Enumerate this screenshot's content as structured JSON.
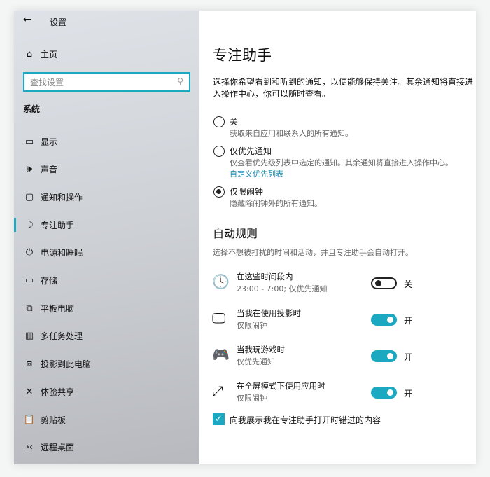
{
  "sidebar": {
    "title": "设置",
    "home": "主页",
    "search_placeholder": "查找设置",
    "section": "系统",
    "items": [
      {
        "label": "显示",
        "icon": "monitor-icon"
      },
      {
        "label": "声音",
        "icon": "speaker-icon"
      },
      {
        "label": "通知和操作",
        "icon": "message-icon"
      },
      {
        "label": "专注助手",
        "icon": "moon-icon"
      },
      {
        "label": "电源和睡眠",
        "icon": "power-icon"
      },
      {
        "label": "存储",
        "icon": "storage-icon"
      },
      {
        "label": "平板电脑",
        "icon": "tablet-icon"
      },
      {
        "label": "多任务处理",
        "icon": "multitask-icon"
      },
      {
        "label": "投影到此电脑",
        "icon": "project-icon"
      },
      {
        "label": "体验共享",
        "icon": "share-icon"
      },
      {
        "label": "剪贴板",
        "icon": "clipboard-icon"
      },
      {
        "label": "远程桌面",
        "icon": "remote-icon"
      }
    ],
    "selected": "专注助手"
  },
  "main": {
    "title": "专注助手",
    "desc": "选择你希望看到和听到的通知，以便能够保持关注。其余通知将直接进入操作中心，你可以随时查看。",
    "options": [
      {
        "label": "关",
        "desc": "获取来自应用和联系人的所有通知。",
        "selected": false
      },
      {
        "label": "仅优先通知",
        "desc": "仅查看优先级列表中选定的通知。其余通知将直接进入操作中心。",
        "link": "自定义优先列表",
        "selected": false
      },
      {
        "label": "仅限闹钟",
        "desc": "隐藏除闹钟外的所有通知。",
        "selected": true
      }
    ],
    "rules_title": "自动规则",
    "rules_desc": "选择不想被打扰的时间和活动，并且专注助手会自动打开。",
    "rules": [
      {
        "title": "在这些时间段内",
        "sub": "23:00 - 7:00; 仅优先通知",
        "state": "关",
        "on": false
      },
      {
        "title": "当我在使用投影时",
        "sub": "仅限闹钟",
        "state": "开",
        "on": true
      },
      {
        "title": "当我玩游戏时",
        "sub": "仅优先通知",
        "state": "开",
        "on": true
      },
      {
        "title": "在全屏模式下使用应用时",
        "sub": "仅限闹钟",
        "state": "开",
        "on": true
      }
    ],
    "checkbox": {
      "label": "向我展示我在专注助手打开时错过的内容",
      "checked": true
    }
  },
  "colors": {
    "accent": "#1aa9c0"
  }
}
